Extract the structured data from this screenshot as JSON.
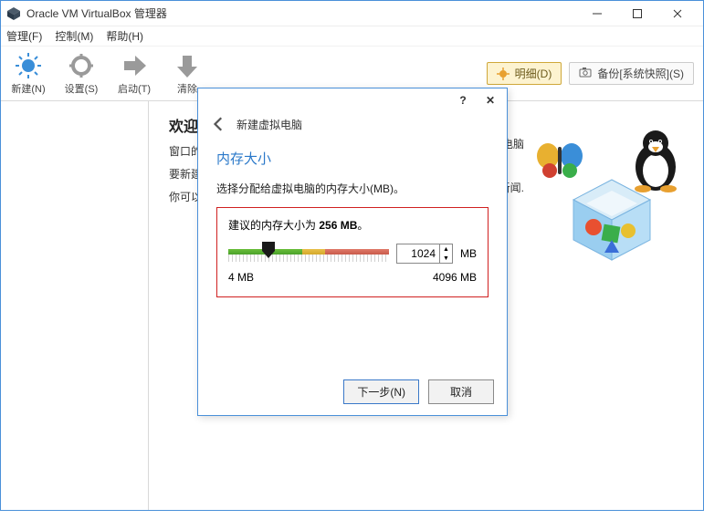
{
  "window": {
    "title": "Oracle VM VirtualBox 管理器"
  },
  "menubar": {
    "file": "管理(F)",
    "control": "控制(M)",
    "help": "帮助(H)"
  },
  "toolbar": {
    "new": "新建(N)",
    "settings": "设置(S)",
    "start": "启动(T)",
    "clear": "清除"
  },
  "header_buttons": {
    "details": "明细(D)",
    "snapshots": "备份[系统快照](S)"
  },
  "welcome": {
    "title": "欢迎使",
    "line1": "窗口的左",
    "line2": "要新建一",
    "line3": "你可以按",
    "right1": "何虚拟电脑",
    "right2": "和新闻."
  },
  "dialog": {
    "title": "新建虚拟电脑",
    "section_title": "内存大小",
    "description": "选择分配给虚拟电脑的内存大小(MB)。",
    "recommend_prefix": "建议的内存大小为 ",
    "recommend_value": "256 MB",
    "recommend_suffix": "。",
    "min_label": "4 MB",
    "max_label": "4096 MB",
    "value": "1024",
    "unit": "MB",
    "next": "下一步(N)",
    "cancel": "取消",
    "help_symbol": "?",
    "close_symbol": "✕"
  },
  "taskbar": "■■·■·■·■■■"
}
